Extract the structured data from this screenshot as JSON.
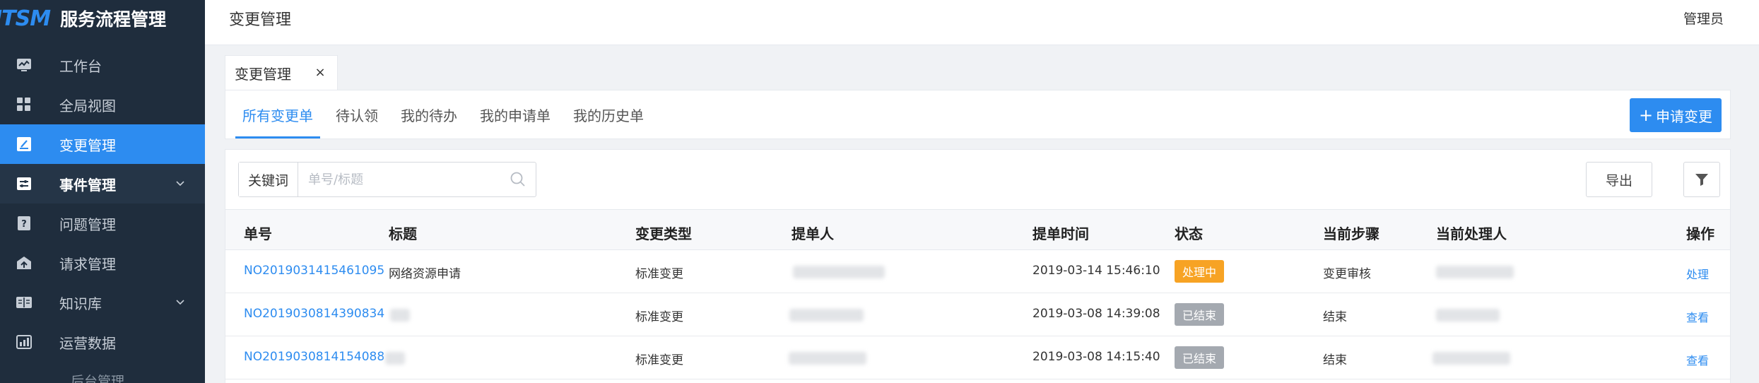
{
  "brand": {
    "logo": "ITSM",
    "title": "服务流程管理"
  },
  "sidebar": {
    "items": [
      {
        "label": "工作台",
        "icon": "dashboard-icon"
      },
      {
        "label": "全局视图",
        "icon": "grid-icon"
      },
      {
        "label": "变更管理",
        "icon": "edit-icon",
        "active": true
      },
      {
        "label": "事件管理",
        "icon": "sliders-icon",
        "open": true
      },
      {
        "label": "问题管理",
        "icon": "question-icon"
      },
      {
        "label": "请求管理",
        "icon": "upload-box-icon"
      },
      {
        "label": "知识库",
        "icon": "book-icon",
        "expandable": true
      },
      {
        "label": "运营数据",
        "icon": "chart-icon"
      }
    ],
    "sub_item": "后台管理"
  },
  "header": {
    "title": "变更管理",
    "user": "管理员"
  },
  "tag": {
    "label": "变更管理",
    "close": "×"
  },
  "tabs": [
    "所有变更单",
    "待认领",
    "我的待办",
    "我的申请单",
    "我的历史单"
  ],
  "apply_button": {
    "plus": "+",
    "label": "申请变更"
  },
  "search": {
    "label": "关键词",
    "placeholder": "单号/标题",
    "value": ""
  },
  "export_button": "导出",
  "table": {
    "headers": [
      "单号",
      "标题",
      "变更类型",
      "提单人",
      "提单时间",
      "状态",
      "当前步骤",
      "当前处理人",
      "操作"
    ],
    "rows": [
      {
        "id": "NO2019031415461095",
        "title": "网络资源申请",
        "type": "标准变更",
        "time": "2019-03-14 15:46:10",
        "status": "处理中",
        "status_kind": "processing",
        "step": "变更审核",
        "action": "处理"
      },
      {
        "id": "NO2019030814390834",
        "title": "",
        "type": "标准变更",
        "time": "2019-03-08 14:39:08",
        "status": "已结束",
        "status_kind": "ended",
        "step": "结束",
        "action": "查看"
      },
      {
        "id": "NO2019030814154088",
        "title": "",
        "type": "标准变更",
        "time": "2019-03-08 14:15:40",
        "status": "已结束",
        "status_kind": "ended",
        "step": "结束",
        "action": "查看"
      }
    ]
  },
  "colors": {
    "sidebar_bg": "#1f2d3d",
    "accent": "#2d8cf0",
    "processing": "#f7a324",
    "ended": "#a4a9b0"
  }
}
